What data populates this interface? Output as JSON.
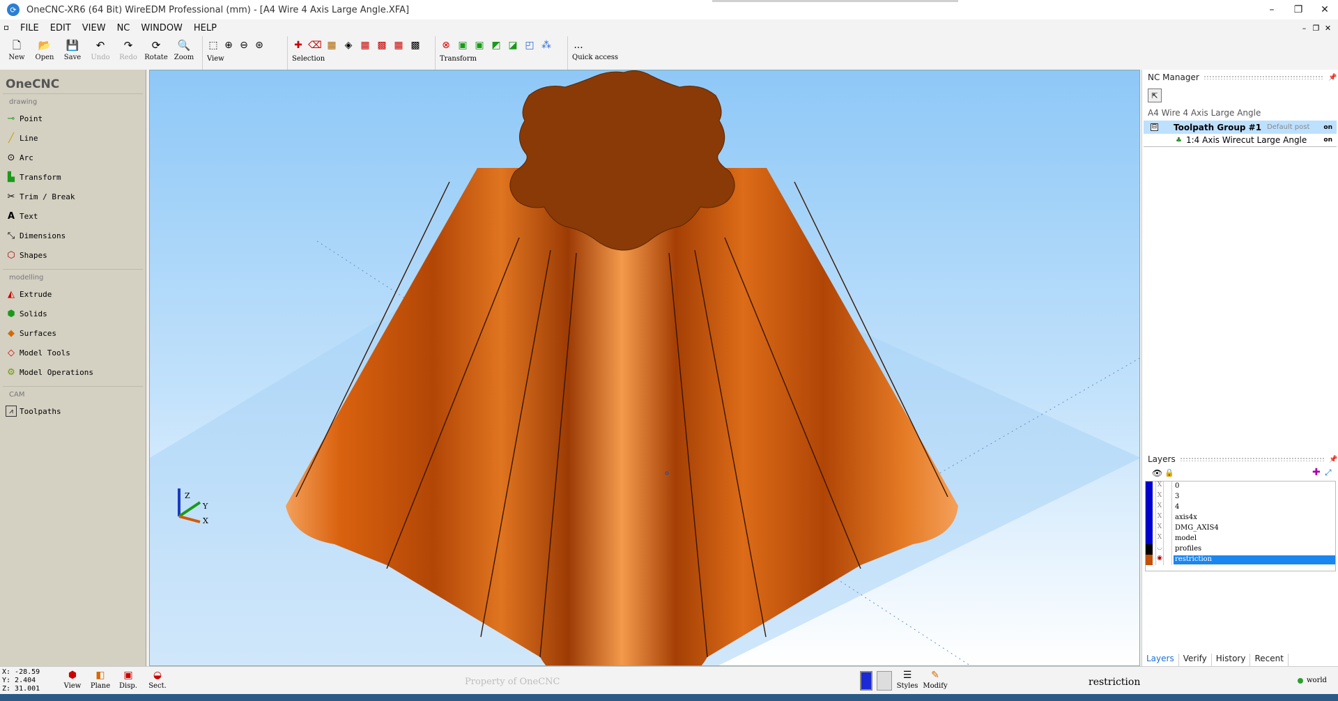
{
  "window": {
    "title": "OneCNC-XR6 (64 Bit) WireEDM Professional (mm) - [A4 Wire 4 Axis Large Angle.XFA]",
    "icon": "onecnc-app-icon"
  },
  "menu": [
    "FILE",
    "EDIT",
    "VIEW",
    "NC",
    "WINDOW",
    "HELP"
  ],
  "toolbar": {
    "file_buttons": [
      {
        "label": "New",
        "icon": "new-file-icon"
      },
      {
        "label": "Open",
        "icon": "open-folder-icon"
      },
      {
        "label": "Save",
        "icon": "save-icon"
      },
      {
        "label": "Undo",
        "icon": "undo-icon",
        "disabled": true
      },
      {
        "label": "Redo",
        "icon": "redo-icon",
        "disabled": true
      },
      {
        "label": "Rotate",
        "icon": "rotate-icon"
      },
      {
        "label": "Zoom",
        "icon": "zoom-icon"
      }
    ],
    "view_label": "View",
    "selection_label": "Selection",
    "transform_label": "Transform",
    "quick_access_label": "Quick access",
    "quick_access_more": "..."
  },
  "sidebar": {
    "brand": "OneCNC",
    "sections": [
      {
        "title": "drawing",
        "items": [
          {
            "label": "Point",
            "icon": "point-icon"
          },
          {
            "label": "Line",
            "icon": "line-icon"
          },
          {
            "label": "Arc",
            "icon": "arc-icon"
          },
          {
            "label": "Transform",
            "icon": "transform-icon"
          },
          {
            "label": "Trim / Break",
            "icon": "trim-icon"
          },
          {
            "label": "Text",
            "icon": "text-icon"
          },
          {
            "label": "Dimensions",
            "icon": "dimensions-icon"
          },
          {
            "label": "Shapes",
            "icon": "shapes-icon"
          }
        ]
      },
      {
        "title": "modelling",
        "items": [
          {
            "label": "Extrude",
            "icon": "extrude-icon"
          },
          {
            "label": "Solids",
            "icon": "solids-icon"
          },
          {
            "label": "Surfaces",
            "icon": "surfaces-icon"
          },
          {
            "label": "Model Tools",
            "icon": "model-tools-icon"
          },
          {
            "label": "Model Operations",
            "icon": "model-operations-icon"
          }
        ]
      },
      {
        "title": "CAM",
        "items": [
          {
            "label": "Toolpaths",
            "icon": "toolpaths-icon"
          }
        ]
      }
    ]
  },
  "viewport": {
    "model_color": "#c2500a",
    "top_face_color": "#8a3a06",
    "axis_labels": {
      "z": "Z",
      "y": "Y",
      "x": "X"
    }
  },
  "nc_manager": {
    "title": "NC Manager",
    "file_name": "A4 Wire 4 Axis Large Angle",
    "group_toggle": "⊟",
    "group": {
      "name": "Toolpath Group #1",
      "post": "Default post",
      "state": "on"
    },
    "operation": {
      "name": "1:4 Axis Wirecut Large Angle",
      "state": "on"
    }
  },
  "layers": {
    "title": "Layers",
    "items": [
      {
        "name": "0",
        "color": "#0000cc",
        "visible": "X",
        "selected": false
      },
      {
        "name": "3",
        "color": "#0000cc",
        "visible": "X",
        "selected": false
      },
      {
        "name": "4",
        "color": "#0000cc",
        "visible": "X",
        "selected": false
      },
      {
        "name": "axis4x",
        "color": "#0000cc",
        "visible": "X",
        "selected": false
      },
      {
        "name": "DMG_AXIS4",
        "color": "#0000cc",
        "visible": "X",
        "selected": false
      },
      {
        "name": "model",
        "color": "#0000cc",
        "visible": "X",
        "selected": false
      },
      {
        "name": "profiles",
        "color": "#000000",
        "visible": "◡",
        "selected": false
      },
      {
        "name": "restriction",
        "color": "#c2500a",
        "visible": "◉",
        "selected": true
      }
    ],
    "tabs": [
      "Layers",
      "Verify",
      "History",
      "Recent"
    ],
    "active_tab": "Layers"
  },
  "status": {
    "x": "X: -28.59",
    "y": "Y: 2.404",
    "z": "Z: 31.001",
    "buttons": [
      "View",
      "Plane",
      "Disp.",
      "Sect."
    ],
    "watermark": "Property of OneCNC",
    "right_buttons": [
      "Styles",
      "Modify"
    ],
    "current_layer": "restriction",
    "coord_system": "world"
  }
}
